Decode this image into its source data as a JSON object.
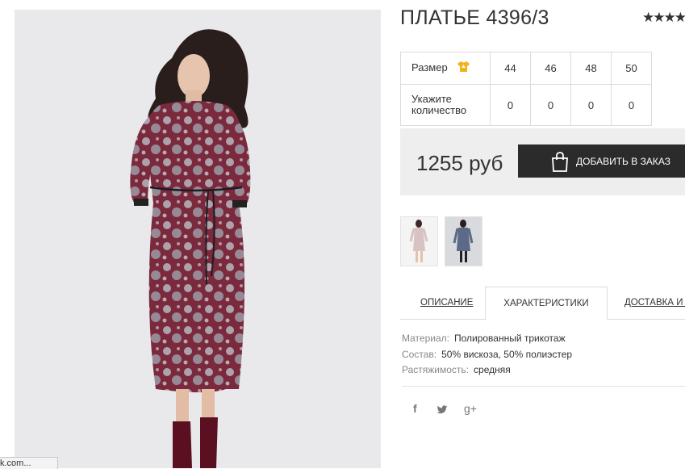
{
  "product": {
    "title": "ПЛАТЬЕ 4396/3",
    "rating_stars": "★★★★"
  },
  "size_table": {
    "size_label": "Размер",
    "qty_label": "Укажите количество",
    "sizes": [
      "44",
      "46",
      "48",
      "50"
    ],
    "quantities": [
      "0",
      "0",
      "0",
      "0"
    ]
  },
  "purchase": {
    "price": "1255 руб",
    "add_button": "ДОБАВИТЬ В ЗАКАЗ"
  },
  "tabs": {
    "description": "ОПИСАНИЕ",
    "characteristics": "ХАРАКТЕРИСТИКИ",
    "delivery": "ДОСТАВКА И О"
  },
  "specs": {
    "material_label": "Материал:",
    "material_value": "Полированный трикотаж",
    "composition_label": "Состав:",
    "composition_value": "50% вискоза, 50% полиэстер",
    "stretch_label": "Растяжимость:",
    "stretch_value": "средняя"
  },
  "social": {
    "facebook": "f",
    "twitter": "twitter-icon",
    "googleplus": "g+"
  },
  "status_bar": {
    "text": "k.com..."
  },
  "colors": {
    "dark_button": "#2b2b2b",
    "price_bar_bg": "#eeeeee",
    "size_icon": "#f2b21b",
    "dress_base": "#7a2a3c"
  }
}
